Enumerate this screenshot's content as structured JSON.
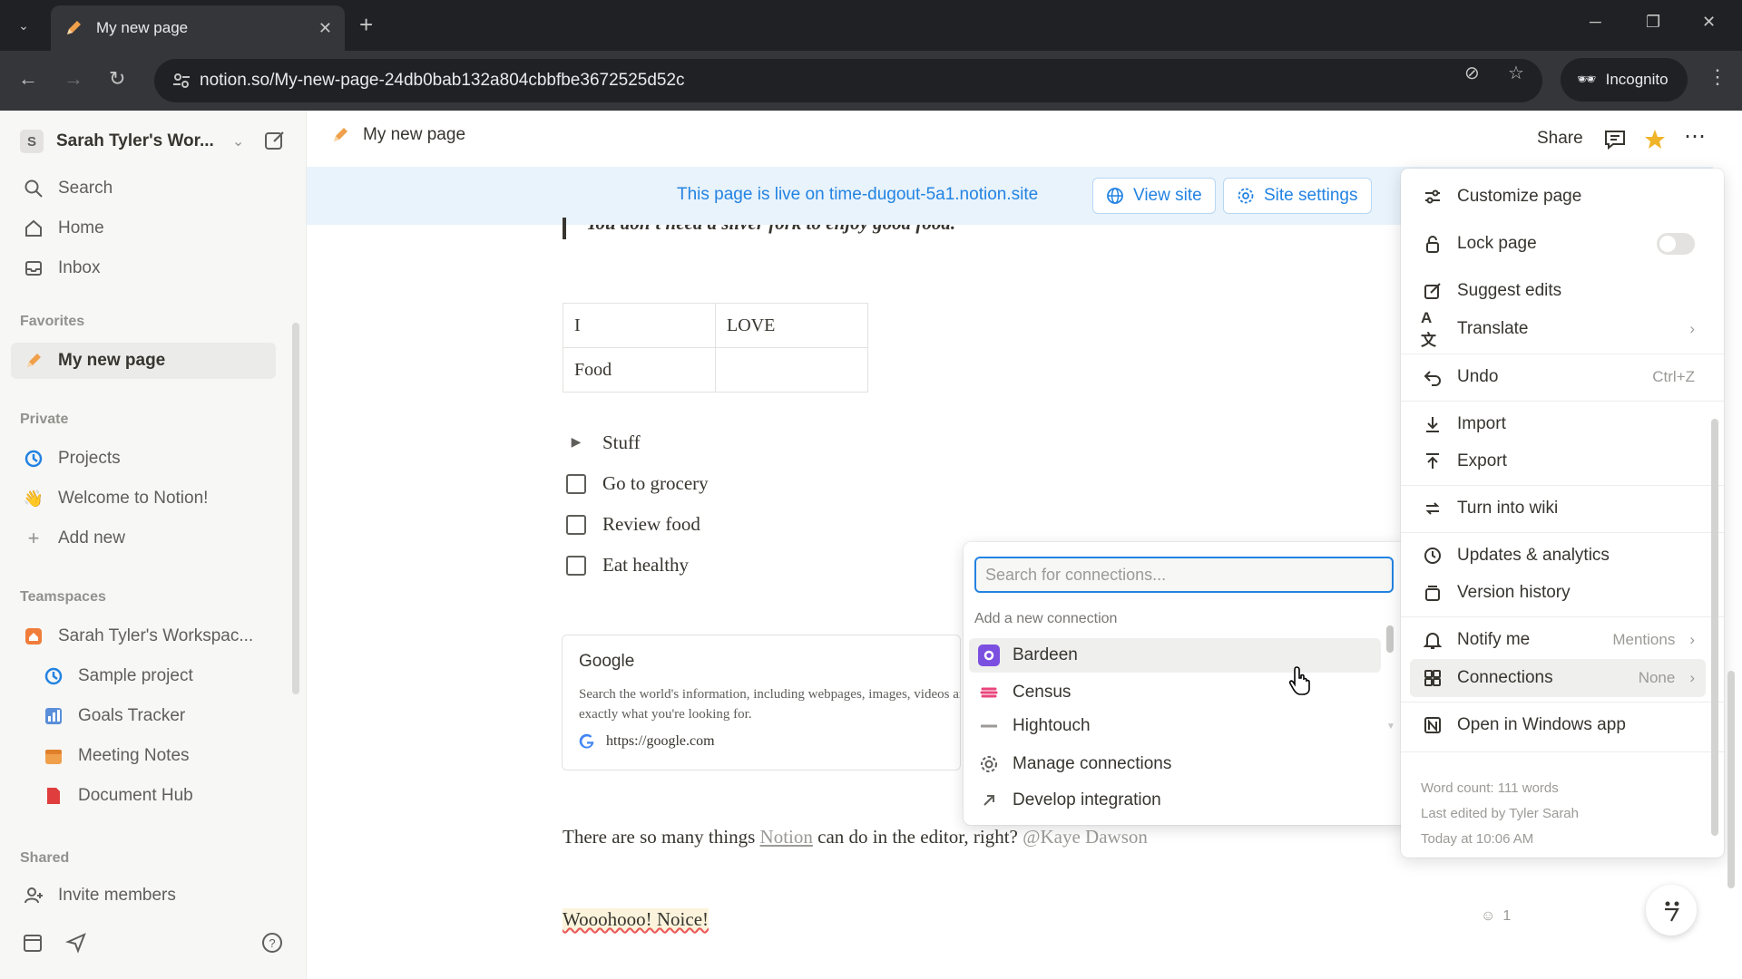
{
  "browser": {
    "tab_title": "My new page",
    "url": "notion.so/My-new-page-24db0bab132a804cbbfbe3672525d52c",
    "incognito_label": "Incognito"
  },
  "sidebar": {
    "workspace_initial": "S",
    "workspace_name": "Sarah Tyler's Wor...",
    "top_items": [
      {
        "label": "Search",
        "icon": "search-icon"
      },
      {
        "label": "Home",
        "icon": "home-icon"
      },
      {
        "label": "Inbox",
        "icon": "inbox-icon"
      }
    ],
    "favorites_label": "Favorites",
    "favorites": [
      {
        "label": "My new page",
        "icon": "pencil-icon"
      }
    ],
    "private_label": "Private",
    "private": [
      {
        "label": "Projects",
        "icon": "projects-icon"
      },
      {
        "label": "Welcome to Notion!",
        "icon": "wave-icon"
      },
      {
        "label": "Add new",
        "icon": "plus-icon"
      }
    ],
    "teamspaces_label": "Teamspaces",
    "teamspaces": [
      {
        "label": "Sarah Tyler's Workspac...",
        "icon": "house-icon"
      },
      {
        "label": "Sample project",
        "icon": "projects-icon"
      },
      {
        "label": "Goals Tracker",
        "icon": "chart-icon"
      },
      {
        "label": "Meeting Notes",
        "icon": "calendar-icon"
      },
      {
        "label": "Document Hub",
        "icon": "document-icon"
      }
    ],
    "shared_label": "Shared",
    "invite_label": "Invite members"
  },
  "topbar": {
    "page_title": "My new page",
    "share_label": "Share"
  },
  "banner": {
    "text": "This page is live on time-dugout-5a1.notion.site",
    "view_site": "View site",
    "site_settings": "Site settings"
  },
  "content": {
    "quote": "You don't need a silver fork to enjoy good food.",
    "table": [
      [
        "I",
        "LOVE"
      ],
      [
        "Food",
        ""
      ]
    ],
    "toggle": "Stuff",
    "todos": [
      "Go to grocery",
      "Review food",
      "Eat healthy"
    ],
    "bookmark": {
      "title": "Google",
      "description": "Search the world's information, including webpages, images, videos and more. Google has many special features to help you find",
      "description2": "exactly what you're looking for.",
      "url": "https://google.com"
    },
    "para_start": "There are so many things ",
    "para_link": "Notion",
    "para_mid": " can do in the editor, right? ",
    "para_mention": "@Kaye Dawson",
    "woo": "Wooohooo! Noice!",
    "reaction_count": "1"
  },
  "connections_popup": {
    "placeholder": "Search for connections...",
    "section_label": "Add a new connection",
    "items": [
      {
        "label": "Bardeen",
        "color": "#7b4fe0"
      },
      {
        "label": "Census",
        "color": "#e8457c"
      },
      {
        "label": "Hightouch",
        "color": "#37352f"
      }
    ],
    "manage": "Manage connections",
    "develop": "Develop integration"
  },
  "page_menu": {
    "items": [
      {
        "label": "Customize page",
        "icon": "sliders-icon"
      },
      {
        "label": "Lock page",
        "icon": "lock-icon"
      },
      {
        "label": "Suggest edits",
        "icon": "edit-icon"
      },
      {
        "label": "Translate",
        "icon": "translate-icon"
      },
      {
        "label": "Undo",
        "icon": "undo-icon",
        "shortcut": "Ctrl+Z"
      },
      {
        "label": "Import",
        "icon": "import-icon"
      },
      {
        "label": "Export",
        "icon": "export-icon"
      },
      {
        "label": "Turn into wiki",
        "icon": "wiki-icon"
      },
      {
        "label": "Updates & analytics",
        "icon": "clock-icon"
      },
      {
        "label": "Version history",
        "icon": "history-icon"
      },
      {
        "label": "Notify me",
        "icon": "bell-icon",
        "value": "Mentions"
      },
      {
        "label": "Connections",
        "icon": "connections-icon",
        "value": "None"
      },
      {
        "label": "Open in Windows app",
        "icon": "notion-app-icon"
      }
    ],
    "word_count": "Word count: 111 words",
    "last_edited": "Last edited by Tyler Sarah",
    "edited_time": "Today at 10:06 AM"
  }
}
